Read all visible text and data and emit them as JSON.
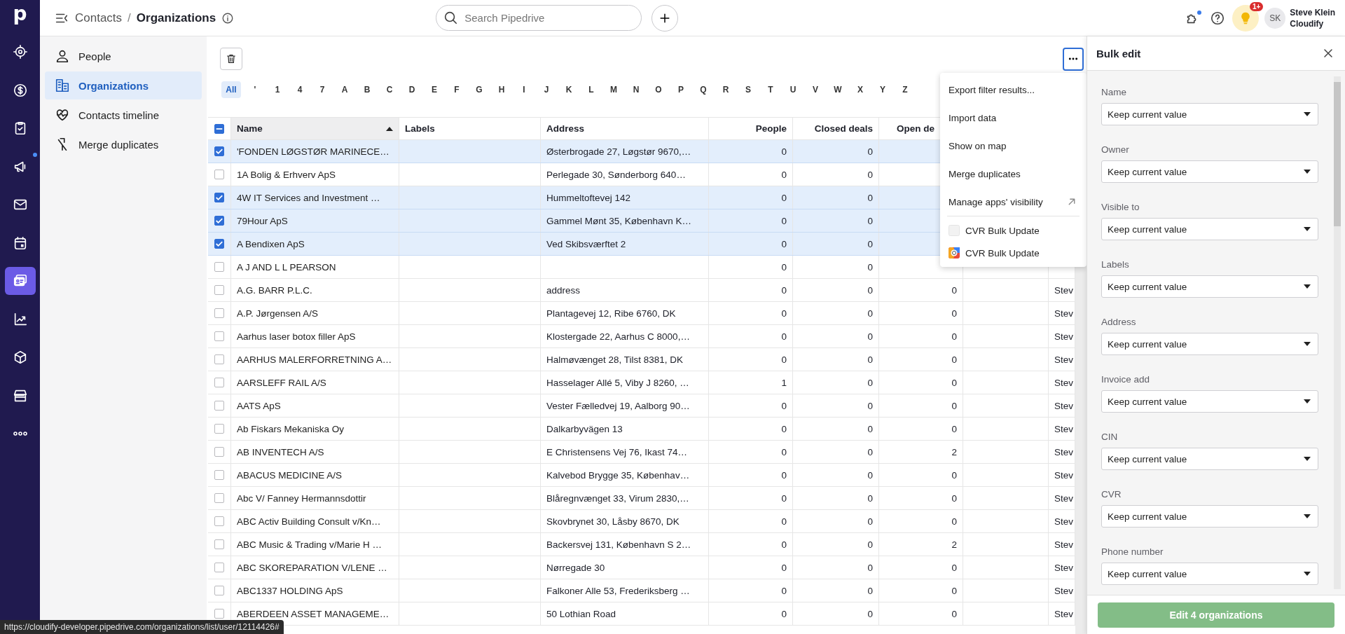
{
  "rail": {
    "logo": "p",
    "items": [
      {
        "kind": "target",
        "selected": false,
        "dot": false
      },
      {
        "kind": "dollar",
        "selected": false,
        "dot": false
      },
      {
        "kind": "clipboard",
        "selected": false,
        "dot": false
      },
      {
        "kind": "megaphone",
        "selected": false,
        "dot": true
      },
      {
        "kind": "mail",
        "selected": false,
        "dot": false
      },
      {
        "kind": "calendar",
        "selected": false,
        "dot": false
      },
      {
        "kind": "contacts",
        "selected": true,
        "dot": false
      },
      {
        "kind": "chart",
        "selected": false,
        "dot": false
      },
      {
        "kind": "box",
        "selected": false,
        "dot": false
      },
      {
        "kind": "store",
        "selected": false,
        "dot": false
      },
      {
        "kind": "more",
        "selected": false,
        "dot": false
      }
    ]
  },
  "topbar": {
    "breadcrumb": {
      "parent": "Contacts",
      "separator": "/",
      "current": "Organizations"
    },
    "search_placeholder": "Search Pipedrive",
    "extensions_dot": true,
    "tips_badge": "1+",
    "user": {
      "initials": "SK",
      "name": "Steve Klein",
      "company": "Cloudify"
    }
  },
  "sidebar": {
    "items": [
      {
        "kind": "person",
        "label": "People",
        "selected": false
      },
      {
        "kind": "building",
        "label": "Organizations",
        "selected": true
      },
      {
        "kind": "heart",
        "label": "Contacts timeline",
        "selected": false
      },
      {
        "kind": "merge",
        "label": "Merge duplicates",
        "selected": false
      }
    ]
  },
  "alphabet": [
    {
      "label": "All",
      "selected": true
    },
    {
      "label": "'",
      "selected": false
    },
    {
      "label": "1",
      "selected": false
    },
    {
      "label": "4",
      "selected": false
    },
    {
      "label": "7",
      "selected": false
    },
    {
      "label": "A",
      "selected": false
    },
    {
      "label": "B",
      "selected": false
    },
    {
      "label": "C",
      "selected": false
    },
    {
      "label": "D",
      "selected": false
    },
    {
      "label": "E",
      "selected": false
    },
    {
      "label": "F",
      "selected": false
    },
    {
      "label": "G",
      "selected": false
    },
    {
      "label": "H",
      "selected": false
    },
    {
      "label": "I",
      "selected": false
    },
    {
      "label": "J",
      "selected": false
    },
    {
      "label": "K",
      "selected": false
    },
    {
      "label": "L",
      "selected": false
    },
    {
      "label": "M",
      "selected": false
    },
    {
      "label": "N",
      "selected": false
    },
    {
      "label": "O",
      "selected": false
    },
    {
      "label": "P",
      "selected": false
    },
    {
      "label": "Q",
      "selected": false
    },
    {
      "label": "R",
      "selected": false
    },
    {
      "label": "S",
      "selected": false
    },
    {
      "label": "T",
      "selected": false
    },
    {
      "label": "U",
      "selected": false
    },
    {
      "label": "V",
      "selected": false
    },
    {
      "label": "W",
      "selected": false
    },
    {
      "label": "X",
      "selected": false
    },
    {
      "label": "Y",
      "selected": false
    },
    {
      "label": "Z",
      "selected": false
    }
  ],
  "table": {
    "header_checkbox": {
      "checked": true,
      "indeterminate": true
    },
    "columns": [
      {
        "label": "Name",
        "sorted": true
      },
      {
        "label": "Labels",
        "sorted": false
      },
      {
        "label": "Address",
        "sorted": false
      },
      {
        "label": "People",
        "sorted": false
      },
      {
        "label": "Closed deals",
        "sorted": false
      },
      {
        "label": "Open de",
        "sorted": false
      }
    ],
    "rows": [
      {
        "selected": true,
        "name": "'FONDEN LØGSTØR MARINECE…",
        "address": "Østerbrogade 27, Løgstør 9670,…",
        "people": "0",
        "closed_deals": "0"
      },
      {
        "selected": false,
        "name": "1A Bolig & Erhverv ApS",
        "address": "Perlegade 30, Sønderborg 640…",
        "people": "0",
        "closed_deals": "0"
      },
      {
        "selected": true,
        "name": "4W IT Services and Investment …",
        "address": "Hummeltoftevej 142",
        "people": "0",
        "closed_deals": "0"
      },
      {
        "selected": true,
        "name": "79Hour ApS",
        "address": "Gammel Mønt 35, København K…",
        "people": "0",
        "closed_deals": "0"
      },
      {
        "selected": true,
        "name": "A Bendixen ApS",
        "address": "Ved Skibsværftet 2",
        "people": "0",
        "closed_deals": "0"
      },
      {
        "selected": false,
        "name": "A J AND L L PEARSON",
        "people": "0",
        "closed_deals": "0"
      },
      {
        "selected": false,
        "name": "A.G. BARR P.L.C.",
        "address": "address",
        "people": "0",
        "closed_deals": "0",
        "open_deals": "0",
        "owner": "Stev"
      },
      {
        "selected": false,
        "name": "A.P. Jørgensen A/S",
        "address": "Plantagevej 12, Ribe 6760, DK",
        "people": "0",
        "closed_deals": "0",
        "open_deals": "0",
        "owner": "Stev"
      },
      {
        "selected": false,
        "name": "Aarhus laser botox filler ApS",
        "address": "Klostergade 22, Aarhus C 8000,…",
        "people": "0",
        "closed_deals": "0",
        "open_deals": "0",
        "owner": "Stev"
      },
      {
        "selected": false,
        "name": "AARHUS MALERFORRETNING A…",
        "address": "Halmøvænget 28, Tilst 8381, DK",
        "people": "0",
        "closed_deals": "0",
        "open_deals": "0",
        "owner": "Stev"
      },
      {
        "selected": false,
        "name": "AARSLEFF RAIL A/S",
        "address": "Hasselager Allé 5, Viby J 8260, …",
        "people": "1",
        "closed_deals": "0",
        "open_deals": "0",
        "owner": "Stev"
      },
      {
        "selected": false,
        "name": "AATS ApS",
        "address": "Vester Fælledvej 19, Aalborg 90…",
        "people": "0",
        "closed_deals": "0",
        "open_deals": "0",
        "owner": "Stev"
      },
      {
        "selected": false,
        "name": "Ab Fiskars Mekaniska Oy",
        "address": "Dalkarbyvägen 13",
        "people": "0",
        "closed_deals": "0",
        "open_deals": "0",
        "owner": "Stev"
      },
      {
        "selected": false,
        "name": "AB INVENTECH A/S",
        "address": "E Christensens Vej 76, Ikast 74…",
        "people": "0",
        "closed_deals": "0",
        "open_deals": "2",
        "owner": "Stev"
      },
      {
        "selected": false,
        "name": "ABACUS MEDICINE A/S",
        "address": "Kalvebod Brygge 35, Københav…",
        "people": "0",
        "closed_deals": "0",
        "open_deals": "0",
        "owner": "Stev"
      },
      {
        "selected": false,
        "name": "Abc V/ Fanney Hermannsdottir",
        "address": "Blåregnvænget 33, Virum 2830,…",
        "people": "0",
        "closed_deals": "0",
        "open_deals": "0",
        "owner": "Stev"
      },
      {
        "selected": false,
        "name": "ABC Activ Building Consult v/Kn…",
        "address": "Skovbrynet 30, Låsby 8670, DK",
        "people": "0",
        "closed_deals": "0",
        "open_deals": "0",
        "owner": "Stev"
      },
      {
        "selected": false,
        "name": "ABC Music & Trading v/Marie H …",
        "address": "Backersvej 131, København S 2…",
        "people": "0",
        "closed_deals": "0",
        "open_deals": "2",
        "owner": "Stev"
      },
      {
        "selected": false,
        "name": "ABC SKOREPARATION V/LENE …",
        "address": "Nørregade 30",
        "people": "0",
        "closed_deals": "0",
        "open_deals": "0",
        "owner": "Stev"
      },
      {
        "selected": false,
        "name": "ABC1337 HOLDING ApS",
        "address": "Falkoner Alle 53, Frederiksberg …",
        "people": "0",
        "closed_deals": "0",
        "open_deals": "0",
        "owner": "Stev"
      },
      {
        "selected": false,
        "name": "ABERDEEN ASSET MANAGEME…",
        "address": "50 Lothian Road",
        "people": "0",
        "closed_deals": "0",
        "open_deals": "0",
        "owner": "Stev"
      }
    ]
  },
  "menu": {
    "items": [
      {
        "kind": "action",
        "label": "Export filter results..."
      },
      {
        "kind": "action",
        "label": "Import data"
      },
      {
        "kind": "action",
        "label": "Show on map"
      },
      {
        "kind": "action",
        "label": "Merge duplicates"
      },
      {
        "kind": "external",
        "label": "Manage apps' visibility"
      },
      {
        "kind": "unbranded",
        "label": "CVR Bulk Update"
      },
      {
        "kind": "branded",
        "label": "CVR Bulk Update"
      }
    ]
  },
  "bulk_edit": {
    "title": "Bulk edit",
    "fields": [
      {
        "label": "Name",
        "value": "Keep current value"
      },
      {
        "label": "Owner",
        "value": "Keep current value"
      },
      {
        "label": "Visible to",
        "value": "Keep current value"
      },
      {
        "label": "Labels",
        "value": "Keep current value"
      },
      {
        "label": "Address",
        "value": "Keep current value"
      },
      {
        "label": "Invoice add",
        "value": "Keep current value"
      },
      {
        "label": "CIN",
        "value": "Keep current value"
      },
      {
        "label": "CVR",
        "value": "Keep current value"
      },
      {
        "label": "Phone number",
        "value": "Keep current value"
      }
    ],
    "submit": {
      "label": "Edit 4 organizations",
      "disabled": true
    }
  },
  "status_url": "https://cloudify-developer.pipedrive.com/organizations/list/user/12114426#"
}
